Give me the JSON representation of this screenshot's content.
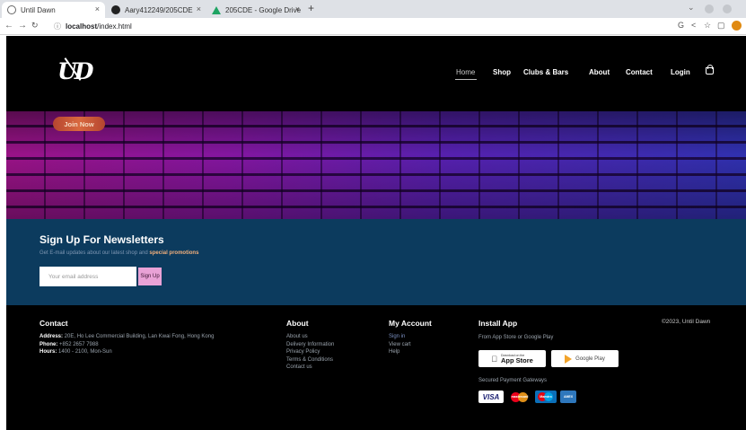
{
  "browser": {
    "tabs": [
      {
        "title": "Until Dawn",
        "active": true
      },
      {
        "title": "Aary412249/205CDE",
        "active": false
      },
      {
        "title": "205CDE - Google Drive",
        "active": false
      }
    ],
    "url_host": "localhost",
    "url_path": "/index.html"
  },
  "site": {
    "logo": "UD",
    "nav": [
      "Home",
      "Shop",
      "Clubs & Bars",
      "About",
      "Contact",
      "Login"
    ],
    "hero": {
      "cta": "Join Now"
    },
    "newsletter": {
      "title": "Sign Up For Newsletters",
      "sub_prefix": "Get E-mail updates about our latest shop and ",
      "sub_highlight": "special promotions",
      "input_placeholder": "Your email address",
      "button": "Sign Up"
    },
    "footer": {
      "contact": {
        "heading": "Contact",
        "address_label": "Address:",
        "address": " 20E, Ho Lee Commercial Building, Lan Kwai Fong, Hong Kong",
        "phone_label": "Phone:",
        "phone": " +852 2657 7988",
        "hours_label": "Hours:",
        "hours": " 1400 - 2100, Mon-Sun"
      },
      "about": {
        "heading": "About",
        "links": [
          "About us",
          "Delivery Information",
          "Privacy Policy",
          "Terms & Conditions",
          "Contact us"
        ]
      },
      "account": {
        "heading": "My Account",
        "links": [
          "Sign in",
          "View cart",
          "Help"
        ]
      },
      "install": {
        "heading": "Install App",
        "sub": "From App Store or Google Play",
        "appstore_small": "Download on the",
        "appstore_big": "App Store",
        "googleplay": "Google Play",
        "payment_label": "Secured Payment Gateways",
        "cards": [
          "VISA",
          "mastercard",
          "Maestro",
          "AMEX"
        ]
      },
      "copyright": "©2023, Until Dawn"
    }
  },
  "colors": {
    "header_bg": "#000000",
    "newsletter_bg": "#0c3b5e",
    "signup_btn": "#e9a2d6",
    "join_btn": "#d9693f",
    "hero_left": "#a2148e",
    "hero_right": "#3233b8"
  }
}
